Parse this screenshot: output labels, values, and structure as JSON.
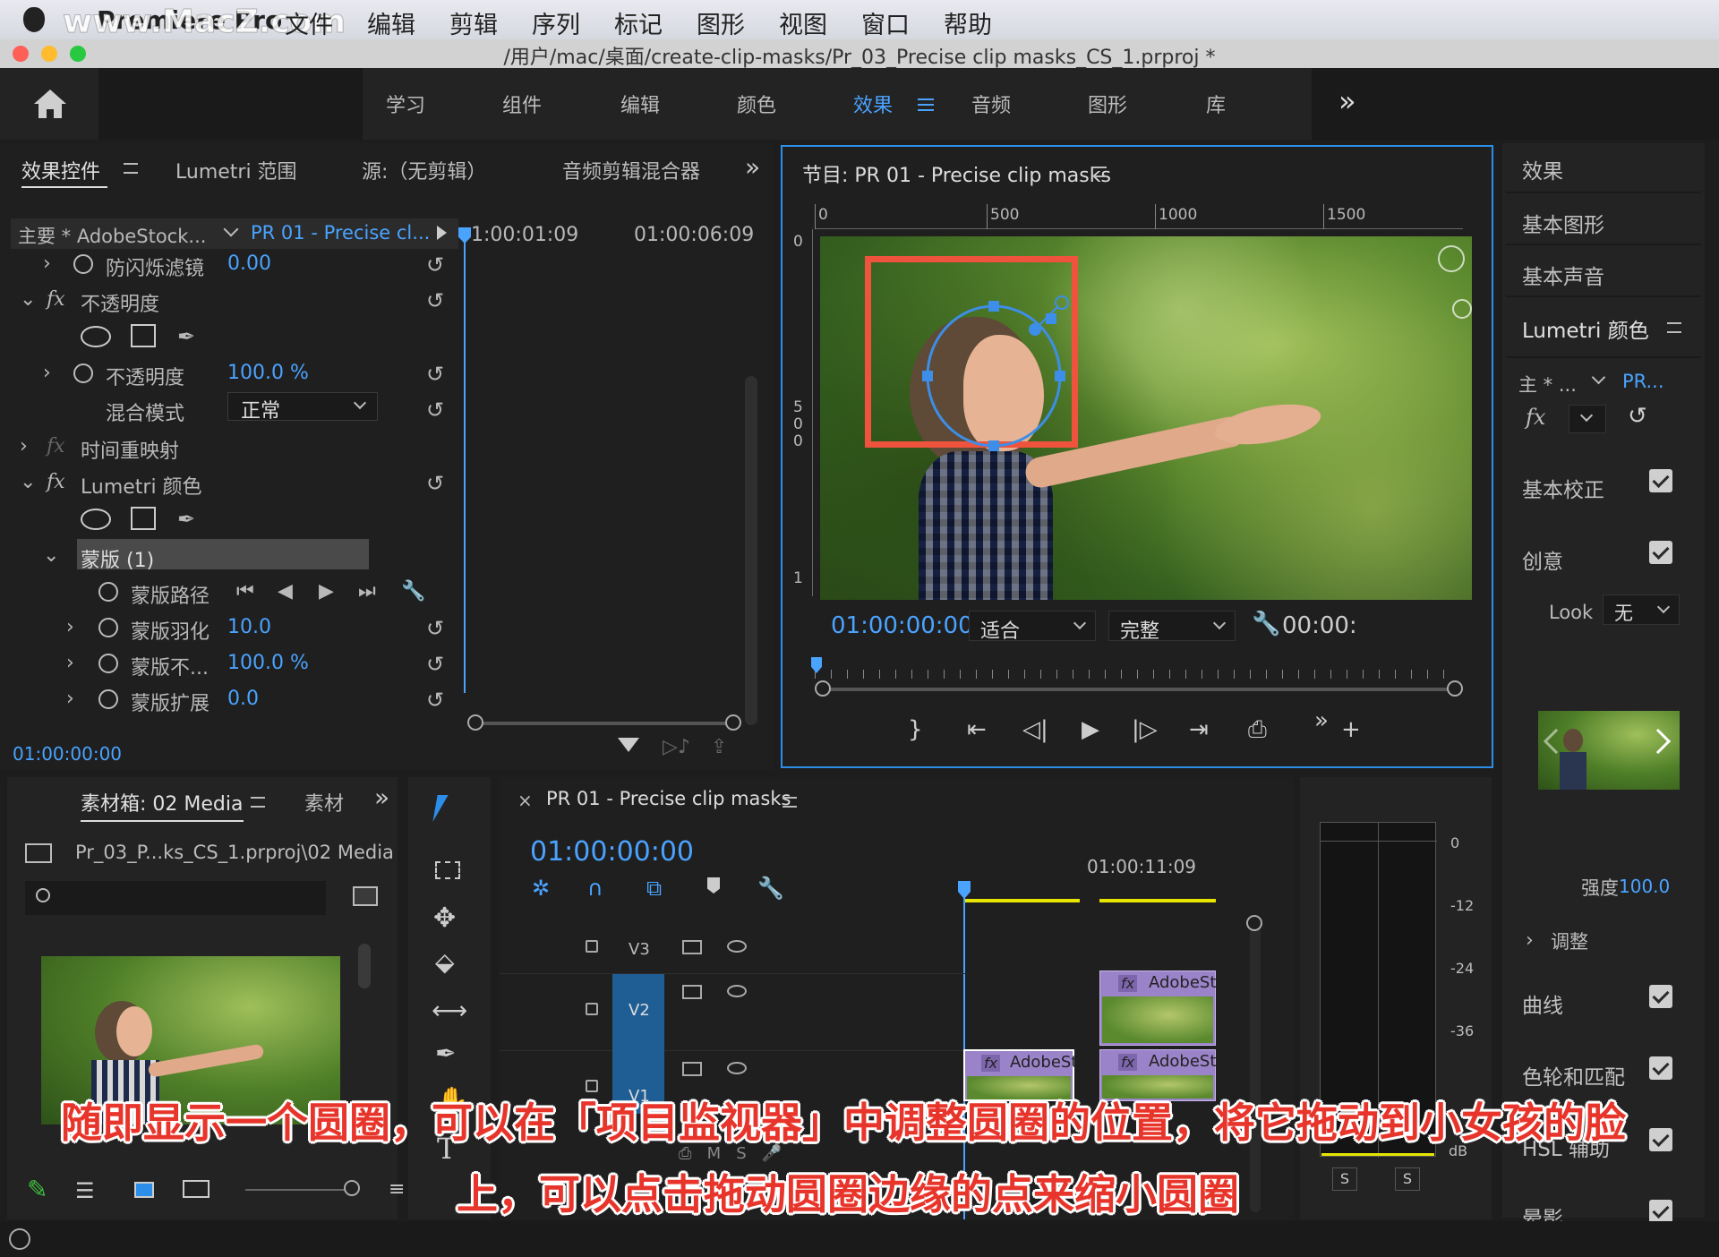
{
  "menubar": {
    "app": "Premiere Pro",
    "watermark": "www.MacZ.com",
    "items": [
      "文件",
      "编辑",
      "剪辑",
      "序列",
      "标记",
      "图形",
      "视图",
      "窗口",
      "帮助"
    ]
  },
  "titlebar": {
    "path": "/用户/mac/桌面/create-clip-masks/Pr_03_Precise clip masks_CS_1.prproj *"
  },
  "workspace": {
    "tabs": [
      "学习",
      "组件",
      "编辑",
      "颜色",
      "效果",
      "音频",
      "图形",
      "库"
    ],
    "active": "效果",
    "more": "»"
  },
  "effect_controls": {
    "tabs": [
      "效果控件",
      "Lumetri 范围",
      "源:（无剪辑）",
      "音频剪辑混合器"
    ],
    "master": "主要 * AdobeStock...",
    "clip": "PR 01 - Precise cl...",
    "time_start": "1:00:01:09",
    "time_end": "01:00:06:09",
    "rows": {
      "flicker": {
        "label": "防闪烁滤镜",
        "value": "0.00"
      },
      "opacity_group": "不透明度",
      "opacity": {
        "label": "不透明度",
        "value": "100.0 %"
      },
      "blend": {
        "label": "混合模式",
        "value": "正常"
      },
      "timeremap": "时间重映射",
      "lumetri": "Lumetri 颜色",
      "mask": "蒙版 (1)",
      "mask_path": "蒙版路径",
      "mask_feather": {
        "label": "蒙版羽化",
        "value": "10.0"
      },
      "mask_opacity": {
        "label": "蒙版不...",
        "value": "100.0 %"
      },
      "mask_expand": {
        "label": "蒙版扩展",
        "value": "0.0"
      }
    },
    "timecode": "01:00:00:00"
  },
  "program_monitor": {
    "title": "节目: PR 01 - Precise clip masks",
    "ruler": [
      "0",
      "500",
      "1000",
      "1500"
    ],
    "vruler": [
      "0",
      "5\n0\n0",
      "1"
    ],
    "timecode": "01:00:00:00",
    "fit": "适合",
    "quality": "完整",
    "duration": "00:00:"
  },
  "right_panel": {
    "items": [
      "效果",
      "基本图形",
      "基本声音",
      "Lumetri 颜色"
    ],
    "master": "主 * ...",
    "clip": "PR...",
    "basic": "基本校正",
    "creative": "创意",
    "look_label": "Look",
    "look_value": "无",
    "strength_label": "强度",
    "strength_value": "100.0",
    "adjust": "调整",
    "curves": "曲线",
    "wheels": "色轮和匹配",
    "hsl": "HSL 辅助",
    "vignette": "晕影"
  },
  "bin": {
    "tab": "素材箱: 02 Media",
    "tab2": "素材",
    "path": "Pr_03_P...ks_CS_1.prproj\\02 Media"
  },
  "timeline": {
    "title": "PR 01 - Precise clip masks",
    "timecode": "01:00:00:00",
    "ruler_time": "01:00:11:09",
    "tracks": [
      "V3",
      "V2",
      "V1"
    ],
    "clip_name": "AdobeSt"
  },
  "meter": {
    "scale": [
      "0",
      "-12",
      "-24",
      "-36"
    ],
    "unit": "dB",
    "solo": "S"
  },
  "subtitle": {
    "line1": "随即显示一个圆圈，可以在「项目监视器」中调整圆圈的位置，将它拖动到小女孩的脸",
    "line2": "上，可以点击拖动圆圈边缘的点来缩小圆圈"
  },
  "colors": {
    "accent": "#4aa3ff",
    "mask_highlight": "#e8352b"
  }
}
